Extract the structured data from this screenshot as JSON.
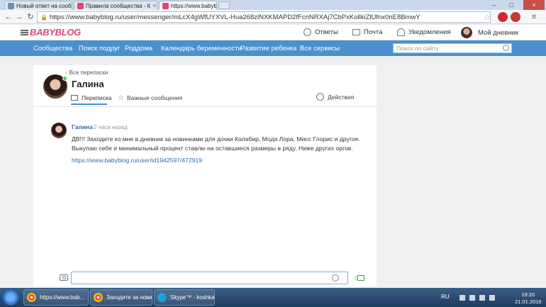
{
  "browser": {
    "tabs": [
      {
        "title": "Новый ответ на сообщени"
      },
      {
        "title": "Правила сообщества - К"
      },
      {
        "title": "https://www.babyblog.ru"
      }
    ],
    "url": "https://www.babyblog.ru/user/messenger/mLcX4gWfUYXVL-Hua268zlNXKMAPD2fFcnNRXAj7CbPxKollkiZlUfnx0nE8BmwY"
  },
  "site": {
    "logo": "BABYBLOG",
    "header": {
      "answers": "Ответы",
      "mail": "Почта",
      "notifications": "Уведомления",
      "my_diary": "Мой дневник"
    },
    "nav": [
      "Сообщества",
      "Поиск подруг",
      "Роддома",
      "Календарь беременности",
      "Развитие ребенка",
      "Все сервисы"
    ],
    "search_placeholder": "Поиск по сайту"
  },
  "conversation": {
    "back_link": "Все переписки",
    "partner_name": "Галина",
    "tabs": [
      "Переписка",
      "Важные сообщения"
    ],
    "actions_label": "Действия",
    "messages": [
      {
        "author": "Галина",
        "time": "2 часа назад",
        "text": "ДВ!!! Заходите ко мне в дневник за новинками для дочки Колабир, Мода Лора, Мисс Глорис и другое. Выкупаю себе и минимальный процент ставлю на оставшиеся размеры в ряду. Ниже других оргов.",
        "link": "https://www.babyblog.ru/user/id1942597/472919"
      }
    ],
    "input_placeholder": ""
  },
  "taskbar": {
    "tasks": [
      "https://www.bab...",
      "Заходите за нови...",
      "Skype™ - koshka..."
    ],
    "lang": "RU",
    "time": "19:20",
    "date": "21.01.2016"
  },
  "colors": {
    "brand": "#e0457b",
    "nav_blue": "#4a90cd",
    "link": "#2a6cb0",
    "online": "#5cc45c"
  }
}
